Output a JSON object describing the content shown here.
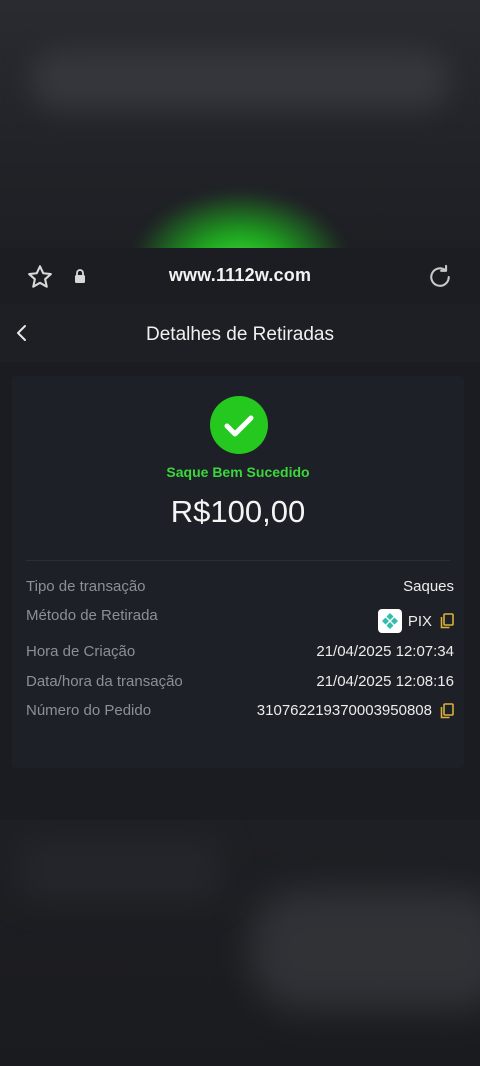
{
  "browser": {
    "url": "www.1112w.com",
    "icons": [
      "star-icon",
      "lock-icon",
      "reload-icon"
    ]
  },
  "header": {
    "title": "Detalhes de Retiradas",
    "back_icon": "chevron-left-icon"
  },
  "receipt": {
    "status": "Saque Bem Sucedido",
    "amount": "R$100,00",
    "status_color": "#24c81e",
    "rows": [
      {
        "label": "Tipo de transação",
        "value": "Saques"
      },
      {
        "label": "Método de Retirada",
        "value": "PIX"
      },
      {
        "label": "Hora de Criação",
        "value": "21/04/2025 12:07:34"
      },
      {
        "label": "Data/hora da transação",
        "value": "21/04/2025 12:08:16"
      },
      {
        "label": "Número do Pedido",
        "value": "310762219370003950808"
      }
    ]
  },
  "colors": {
    "accent_green": "#3bd63b",
    "copy_icon": "#d8b23a",
    "pix_logo": "#32bcad"
  }
}
